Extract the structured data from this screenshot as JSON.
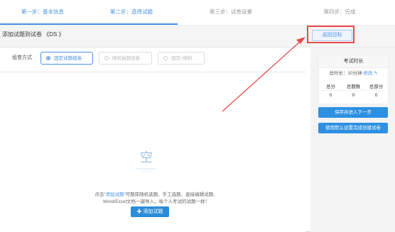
{
  "steps": [
    {
      "label": "第一步：基本信息"
    },
    {
      "label": "第二步：选择试题"
    },
    {
      "label": "第三步：试卷设置"
    },
    {
      "label": "第四步：完成"
    }
  ],
  "header": {
    "title": "添加试题到试卷 《DS 》",
    "back_label": "返回目标"
  },
  "compose": {
    "label": "组卷方式",
    "options": [
      {
        "label": "固定试题组卷",
        "selected": true
      },
      {
        "label": "随机抽题组卷",
        "selected": false
      },
      {
        "label": "固定+随机",
        "selected": false
      }
    ]
  },
  "empty": {
    "icon_char": "空",
    "line1_prefix": "点击",
    "line1_link": "“添加试题”",
    "line1_suffix": "可题库随机选题、手工选题、直接编辑试题、",
    "line2": "Word/Excel文档一键导入，每个人考试的试题一样！",
    "add_label": "添加试题"
  },
  "sidebar": {
    "card_title": "考试时长",
    "duration_label": "总时长：",
    "duration_value": "10分钟",
    "edit_label": "修改",
    "stats_headers": [
      "总分",
      "总题数",
      "总部分"
    ],
    "stats_values": [
      "0",
      "0",
      "0"
    ],
    "save_next": "保存并进入下一步",
    "default_create": "使用默认设置完成创建试卷"
  },
  "colors": {
    "accent": "#4a90e2",
    "primary_button": "#2d90e2",
    "highlight": "#e84b4b"
  }
}
